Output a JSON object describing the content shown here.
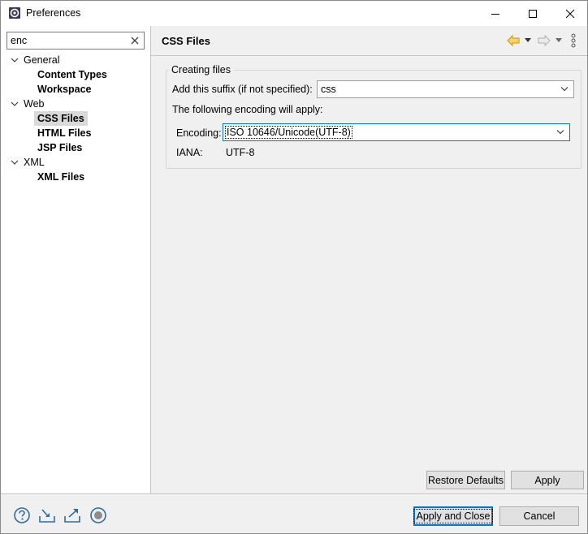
{
  "window": {
    "title": "Preferences",
    "icons": {
      "app": "preferences-gear-icon"
    }
  },
  "filter": {
    "value": "enc"
  },
  "tree": {
    "groups": [
      {
        "label": "General",
        "children": [
          "Content Types",
          "Workspace"
        ]
      },
      {
        "label": "Web",
        "children": [
          "CSS Files",
          "HTML Files",
          "JSP Files"
        ]
      },
      {
        "label": "XML",
        "children": [
          "XML Files"
        ]
      }
    ],
    "selected": "CSS Files"
  },
  "page": {
    "title": "CSS Files",
    "group_label": "Creating files",
    "suffix_label": "Add this suffix (if not specified):",
    "suffix_value": "css",
    "encoding_note": "The following encoding will apply:",
    "encoding_label": "Encoding:",
    "encoding_value": "ISO 10646/Unicode(UTF-8)",
    "iana_label": "IANA:",
    "iana_value": "UTF-8"
  },
  "buttons": {
    "restore_defaults": "Restore Defaults",
    "apply": "Apply",
    "apply_and_close": "Apply and Close",
    "cancel": "Cancel"
  },
  "colors": {
    "accent": "#0078d7",
    "nav_arrow": "#e0a800"
  }
}
